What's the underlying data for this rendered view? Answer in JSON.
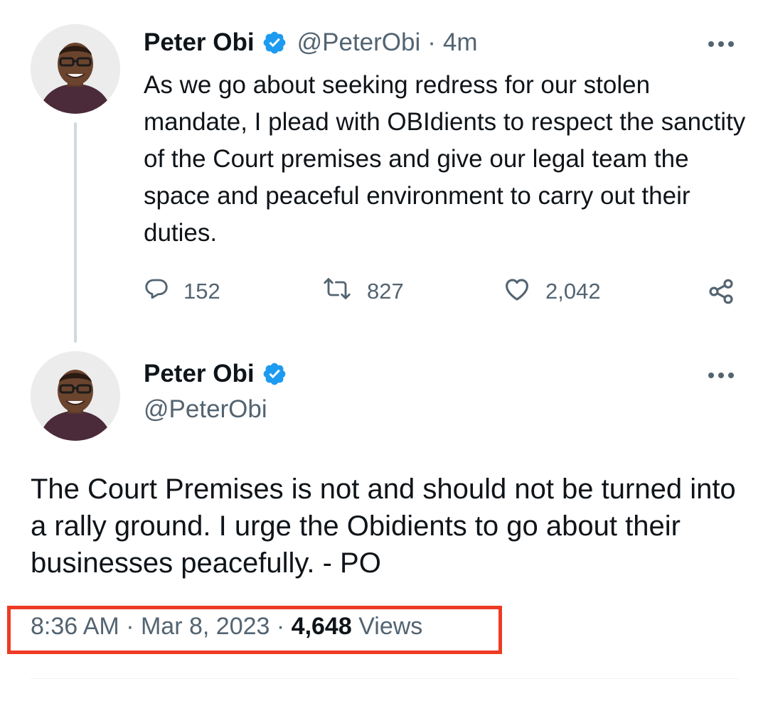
{
  "tweet1": {
    "display_name": "Peter Obi",
    "handle": "@PeterObi",
    "separator": "·",
    "time_ago": "4m",
    "text": "As we go about seeking redress for our stolen mandate, I plead with OBIdients to respect the sanctity of the Court premises and give our legal team the space and peaceful environment to carry out their duties.",
    "actions": {
      "replies": "152",
      "retweets": "827",
      "likes": "2,042"
    }
  },
  "tweet2": {
    "display_name": "Peter Obi",
    "handle": "@PeterObi",
    "text": "The Court Premises is not and should not be turned into a rally ground. I urge the Obidients to go about their businesses peacefully.  - PO",
    "time": "8:36 AM",
    "date": "Mar 8, 2023",
    "separator": "·",
    "views_count": "4,648",
    "views_label": "Views"
  },
  "icons": {
    "verified": "verified-badge-icon",
    "more": "more-horizontal-icon",
    "reply": "reply-icon",
    "retweet": "retweet-icon",
    "like": "heart-icon",
    "share": "share-icon"
  },
  "colors": {
    "verified_blue": "#1d9bf0",
    "text_primary": "#0f1419",
    "text_secondary": "#536471",
    "highlight_box": "#ef3b24",
    "thread_line": "#cfd9de"
  }
}
